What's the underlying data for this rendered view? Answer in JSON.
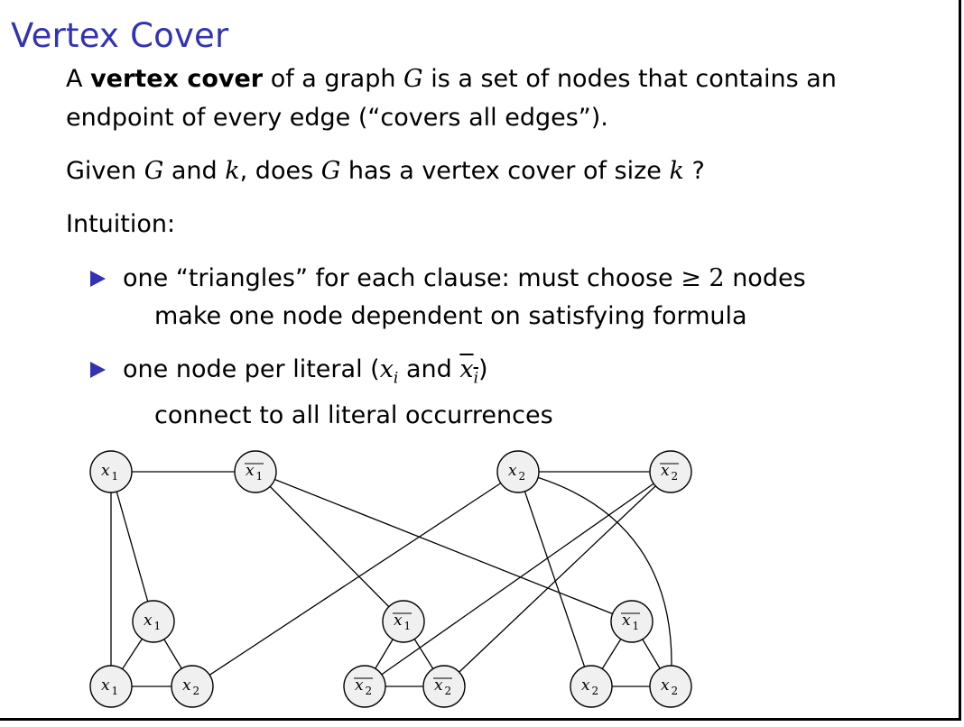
{
  "slide": {
    "title": "Vertex Cover",
    "def": {
      "pre": "A ",
      "bold": "vertex cover",
      "mid": " of a graph ",
      "G": "G",
      "post": " is a set of nodes that contains an",
      "line2": "endpoint of every edge (“covers all edges”)."
    },
    "question": {
      "a": "Given ",
      "G1": "G",
      "b": " and ",
      "k1": "k",
      "c": ", does ",
      "G2": "G",
      "d": " has a vertex cover of size ",
      "k2": "k",
      "e": " ?"
    },
    "intuition": "Intuition:",
    "bullets": [
      {
        "line1_a": "one “triangles” for each clause: must choose ",
        "geq": "≥ 2",
        "line1_b": " nodes",
        "line2": "make one node dependent on satisfying formula"
      },
      {
        "line1_a": "one node per literal (",
        "xi": "x",
        "i1": "i",
        "and": " and ",
        "xbar": "x",
        "i2": "i",
        "close": ")",
        "line2": "connect to all literal occurrences"
      }
    ]
  },
  "graph": {
    "nodes": [
      {
        "id": "top-x1",
        "var": "x",
        "sub": "1",
        "negated": false
      },
      {
        "id": "top-notx1",
        "var": "x",
        "sub": "1",
        "negated": true
      },
      {
        "id": "top-x2",
        "var": "x",
        "sub": "2",
        "negated": false
      },
      {
        "id": "top-notx2",
        "var": "x",
        "sub": "2",
        "negated": true
      },
      {
        "id": "c1-top",
        "var": "x",
        "sub": "1",
        "negated": false
      },
      {
        "id": "c1-left",
        "var": "x",
        "sub": "1",
        "negated": false
      },
      {
        "id": "c1-right",
        "var": "x",
        "sub": "2",
        "negated": false
      },
      {
        "id": "c2-top",
        "var": "x",
        "sub": "1",
        "negated": true
      },
      {
        "id": "c2-left",
        "var": "x",
        "sub": "2",
        "negated": true
      },
      {
        "id": "c2-right",
        "var": "x",
        "sub": "2",
        "negated": true
      },
      {
        "id": "c3-top",
        "var": "x",
        "sub": "1",
        "negated": true
      },
      {
        "id": "c3-left",
        "var": "x",
        "sub": "2",
        "negated": false
      },
      {
        "id": "c3-right",
        "var": "x",
        "sub": "2",
        "negated": false
      }
    ],
    "edges": [
      [
        "top-x1",
        "top-notx1"
      ],
      [
        "top-x2",
        "top-notx2"
      ],
      [
        "c1-top",
        "c1-left"
      ],
      [
        "c1-top",
        "c1-right"
      ],
      [
        "c1-left",
        "c1-right"
      ],
      [
        "c2-top",
        "c2-left"
      ],
      [
        "c2-top",
        "c2-right"
      ],
      [
        "c2-left",
        "c2-right"
      ],
      [
        "c3-top",
        "c3-left"
      ],
      [
        "c3-top",
        "c3-right"
      ],
      [
        "c3-left",
        "c3-right"
      ],
      [
        "top-x1",
        "c1-top"
      ],
      [
        "top-x1",
        "c1-left"
      ],
      [
        "top-notx1",
        "c2-top"
      ],
      [
        "top-notx1",
        "c3-top"
      ],
      [
        "top-x2",
        "c1-right"
      ],
      [
        "top-x2",
        "c3-left"
      ],
      [
        "top-x2",
        "c3-right"
      ],
      [
        "top-notx2",
        "c2-left"
      ],
      [
        "top-notx2",
        "c2-right"
      ]
    ]
  }
}
